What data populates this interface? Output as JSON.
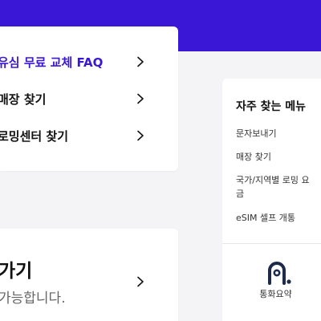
{
  "colors": {
    "accent": "#3a17d6",
    "background": "#f4f4f6",
    "card": "#ffffff",
    "icon": "#1e2a4a"
  },
  "links": [
    {
      "label": "유심 무료 교체 FAQ",
      "icon": "chevron-right-icon"
    },
    {
      "label": "매장 찾기",
      "icon": "chevron-right-icon"
    },
    {
      "label": "로밍센터 찾기",
      "icon": "chevron-right-icon"
    }
  ],
  "promo": {
    "title": "가기",
    "subtitle": "가능합니다.",
    "icon": "chevron-right-icon"
  },
  "faq_menu": {
    "title": "자주 찾는 메뉴",
    "items": [
      {
        "label": "문자보내기"
      },
      {
        "label": "매장 찾기"
      },
      {
        "label": "국가/지역별 로밍 요금"
      },
      {
        "label": "eSIM 셀프 개통"
      }
    ],
    "quick_action": {
      "label": "통화요약",
      "icon": "call-summary-icon"
    }
  }
}
